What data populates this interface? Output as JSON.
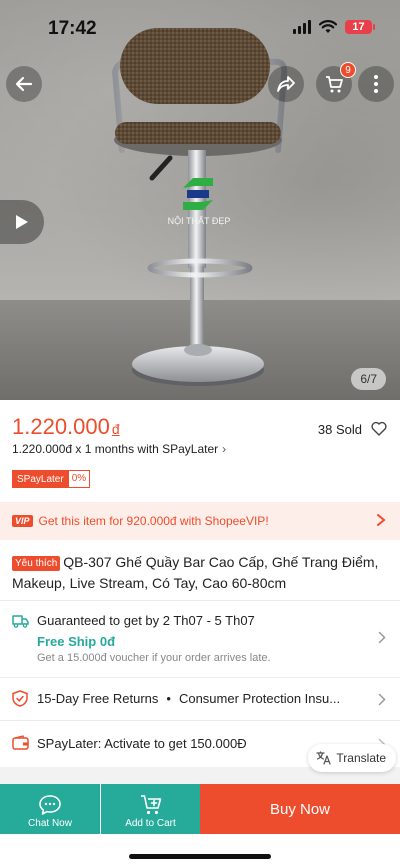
{
  "status_bar": {
    "time": "17:42",
    "battery": "17"
  },
  "header": {
    "cart_count": "9"
  },
  "gallery": {
    "counter": "6/7",
    "watermark": "NỘI THẤT ĐẸP"
  },
  "price": {
    "amount": "1.220.000",
    "currency": "đ",
    "sold": "38 Sold",
    "installment": "1.220.000đ x 1 months with SPayLater",
    "tag_label": "SPayLater",
    "tag_value": "0%"
  },
  "vip_banner": {
    "badge": "VIP",
    "text": "Get this item for 920.000đ with ShopeeVIP!"
  },
  "product": {
    "badge": "Yêu thích",
    "title": "QB-307 Ghế Quầy Bar Cao Cấp, Ghế Trang Điểm, Makeup, Live Stream, Có Tay, Cao 60-80cm"
  },
  "shipping": {
    "guarantee": "Guaranteed to get by 2 Th07 - 5 Th07",
    "free_ship": "Free Ship 0đ",
    "voucher_note": "Get a 15.000đ voucher if your order arrives late."
  },
  "returns": {
    "returns_label": "15-Day Free Returns",
    "protection_label": "Consumer Protection Insu..."
  },
  "spaylater_row": {
    "label": "SPayLater: Activate to get 150.000Đ"
  },
  "translate": {
    "label": "Translate"
  },
  "bottom_bar": {
    "chat_label": "Chat Now",
    "cart_label": "Add to Cart",
    "buy_label": "Buy Now"
  },
  "colors": {
    "primary": "#ee4d2d",
    "teal": "#26aa99",
    "vip_bg": "#fdeee9"
  },
  "icons": [
    "back-icon",
    "share-icon",
    "cart-icon",
    "more-icon",
    "play-icon",
    "heart-icon",
    "truck-icon",
    "shield-return-icon",
    "wallet-icon",
    "translate-icon",
    "chat-icon",
    "add-cart-icon"
  ]
}
